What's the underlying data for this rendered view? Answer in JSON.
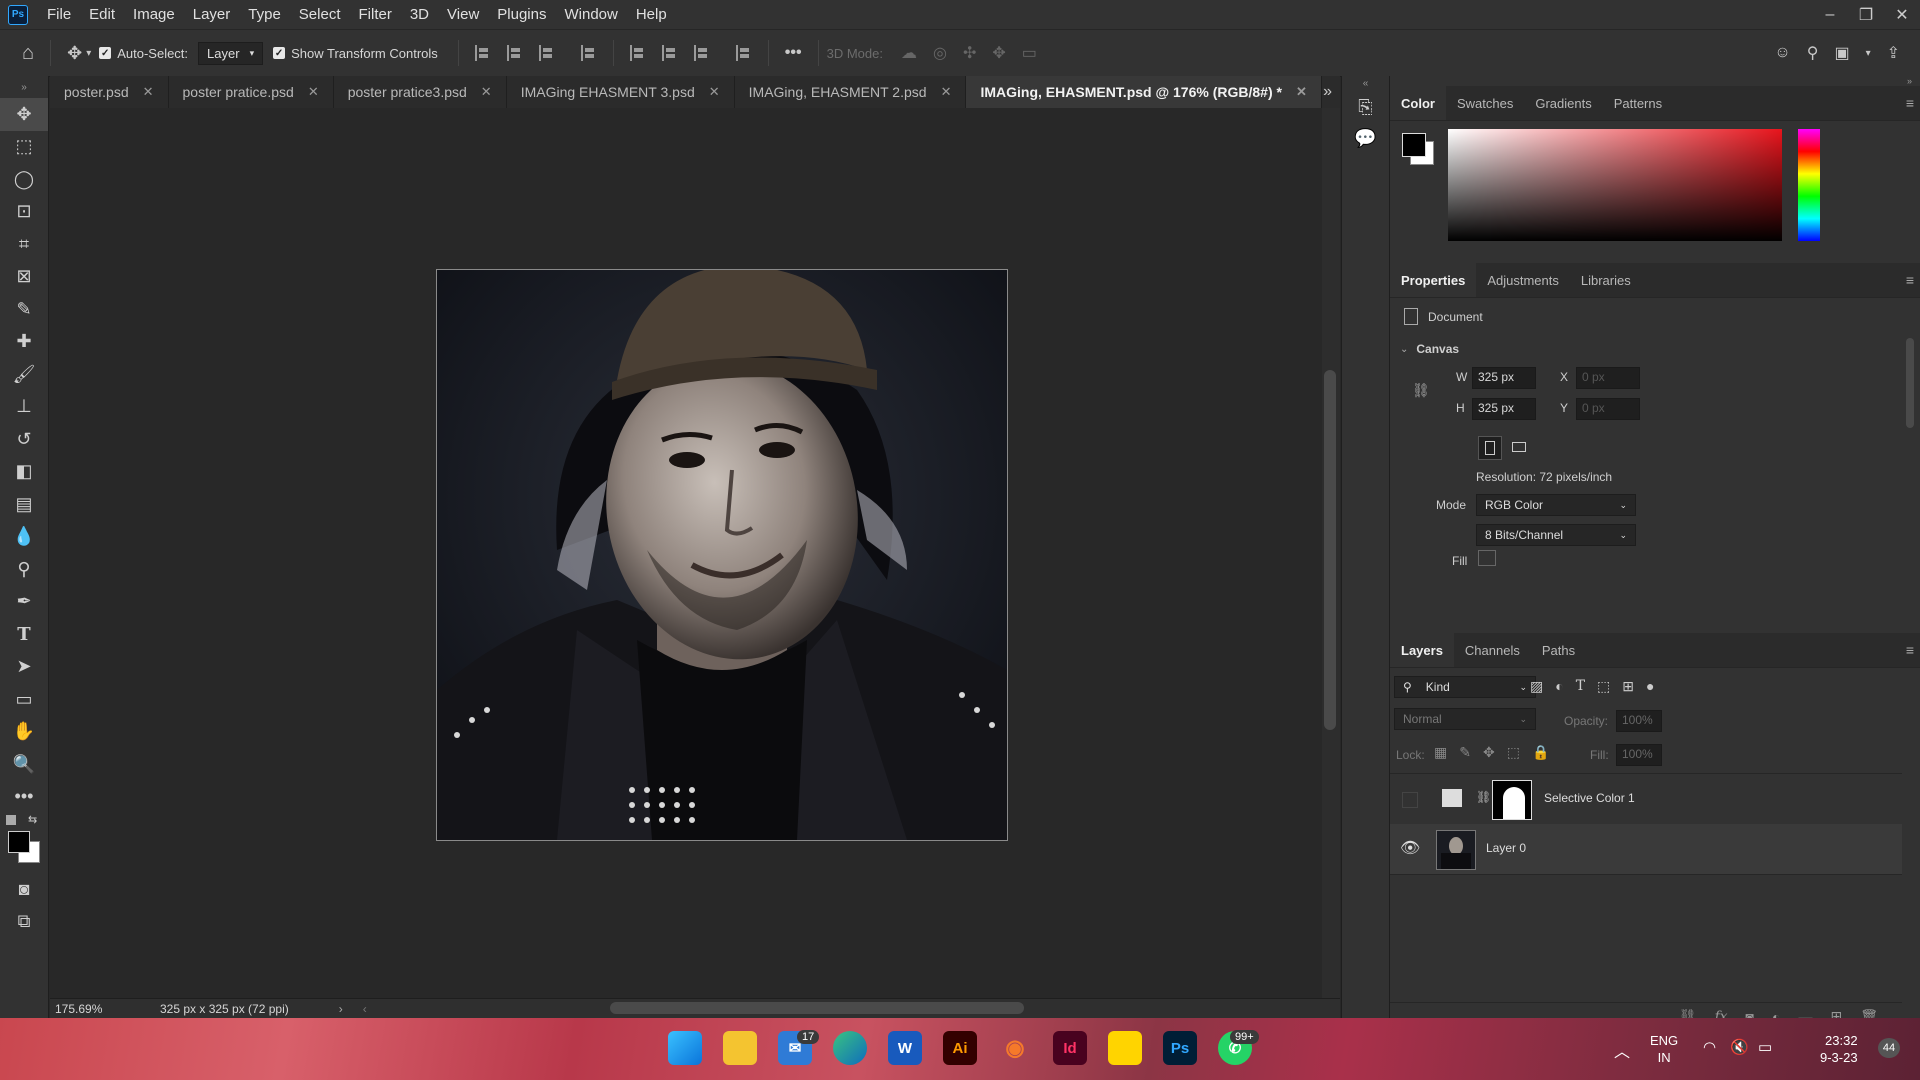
{
  "app": {
    "logo": "Ps"
  },
  "menu": [
    "File",
    "Edit",
    "Image",
    "Layer",
    "Type",
    "Select",
    "Filter",
    "3D",
    "View",
    "Plugins",
    "Window",
    "Help"
  ],
  "window_controls": {
    "minimize": "–",
    "restore": "❐",
    "close": "✕"
  },
  "options_bar": {
    "auto_select_label": "Auto-Select:",
    "auto_select_value": "Layer",
    "show_transform_label": "Show Transform Controls",
    "more": "•••",
    "mode_3d_label": "3D Mode:"
  },
  "tabs": [
    {
      "label": "poster.psd"
    },
    {
      "label": "poster pratice.psd"
    },
    {
      "label": "poster pratice3.psd"
    },
    {
      "label": "IMAGing EHASMENT 3.psd"
    },
    {
      "label": "IMAGing, EHASMENT 2.psd"
    },
    {
      "label": "IMAGing, EHASMENT.psd @ 176% (RGB/8#) *"
    }
  ],
  "status": {
    "zoom": "175.69%",
    "doc_info": "325 px x 325 px (72 ppi)"
  },
  "color_panel": {
    "tabs": [
      "Color",
      "Swatches",
      "Gradients",
      "Patterns"
    ],
    "foreground": "#000000",
    "background": "#ffffff",
    "hue": "#e8141c"
  },
  "properties_panel": {
    "tabs": [
      "Properties",
      "Adjustments",
      "Libraries"
    ],
    "doc_label": "Document",
    "section": "Canvas",
    "w_label": "W",
    "w_value": "325 px",
    "h_label": "H",
    "h_value": "325 px",
    "x_label": "X",
    "x_value": "0 px",
    "y_label": "Y",
    "y_value": "0 px",
    "resolution": "Resolution: 72 pixels/inch",
    "mode_label": "Mode",
    "mode_value": "RGB Color",
    "bits_value": "8 Bits/Channel",
    "fill_label": "Fill"
  },
  "layers_panel": {
    "tabs": [
      "Layers",
      "Channels",
      "Paths"
    ],
    "filter_kind": "Kind",
    "blend_mode": "Normal",
    "opacity_label": "Opacity:",
    "opacity_value": "100%",
    "lock_label": "Lock:",
    "fill_label": "Fill:",
    "fill_value": "100%",
    "layers": [
      {
        "name": "Selective Color 1",
        "visible": false
      },
      {
        "name": "Layer 0",
        "visible": true
      }
    ],
    "footer_fx": "fx"
  },
  "taskbar": {
    "mail_badge": "17",
    "whatsapp_badge": "99+",
    "lang_top": "ENG",
    "lang_bottom": "IN",
    "time": "23:32",
    "date": "9-3-23",
    "notif_badge": "44",
    "apps": [
      "Ai",
      "Id",
      "Ps"
    ]
  }
}
